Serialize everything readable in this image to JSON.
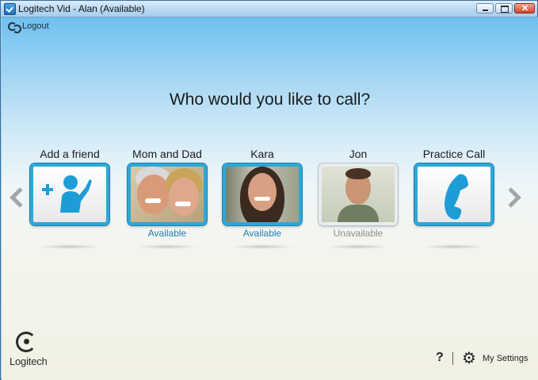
{
  "window": {
    "title": "Logitech Vid - Alan (Available)"
  },
  "toolbar": {
    "logout_label": "Logout"
  },
  "main": {
    "headline": "Who would you like to call?"
  },
  "contacts": [
    {
      "name": "Add a friend",
      "status": "",
      "kind": "add-friend-icon"
    },
    {
      "name": "Mom and Dad",
      "status": "Available"
    },
    {
      "name": "Kara",
      "status": "Available"
    },
    {
      "name": "Jon",
      "status": "Unavailable"
    },
    {
      "name": "Practice Call",
      "status": "",
      "kind": "phone-icon"
    }
  ],
  "footer": {
    "brand": "Logitech",
    "help_label": "?",
    "settings_label": "My Settings"
  },
  "colors": {
    "accent": "#2ea7d6",
    "available": "#1f7fb8",
    "unavailable": "#8a8f93"
  }
}
